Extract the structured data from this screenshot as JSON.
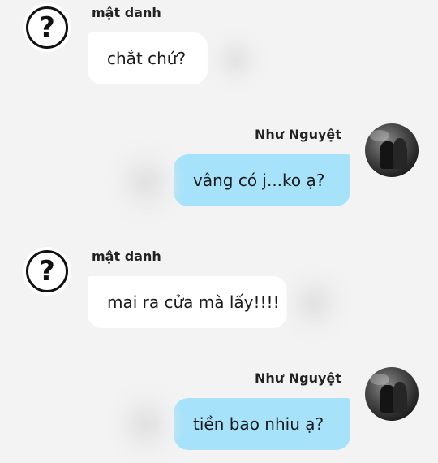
{
  "messages": [
    {
      "sender": "mật danh",
      "text": "chắt chứ?"
    },
    {
      "sender": "Như Nguyệt",
      "text": "vâng có j...ko ạ?"
    },
    {
      "sender": "mật danh",
      "text": "mai ra cửa mà lấy!!!!"
    },
    {
      "sender": "Như Nguyệt",
      "text": "tiền bao nhiu ạ?"
    }
  ],
  "avatars": {
    "anonymous_glyph": "?",
    "anonymous_icon": "question-mark-icon",
    "user_icon": "profile-photo"
  },
  "colors": {
    "background": "#f3f3f3",
    "incoming_bubble": "#ffffff",
    "outgoing_bubble": "#a6e3fb"
  }
}
